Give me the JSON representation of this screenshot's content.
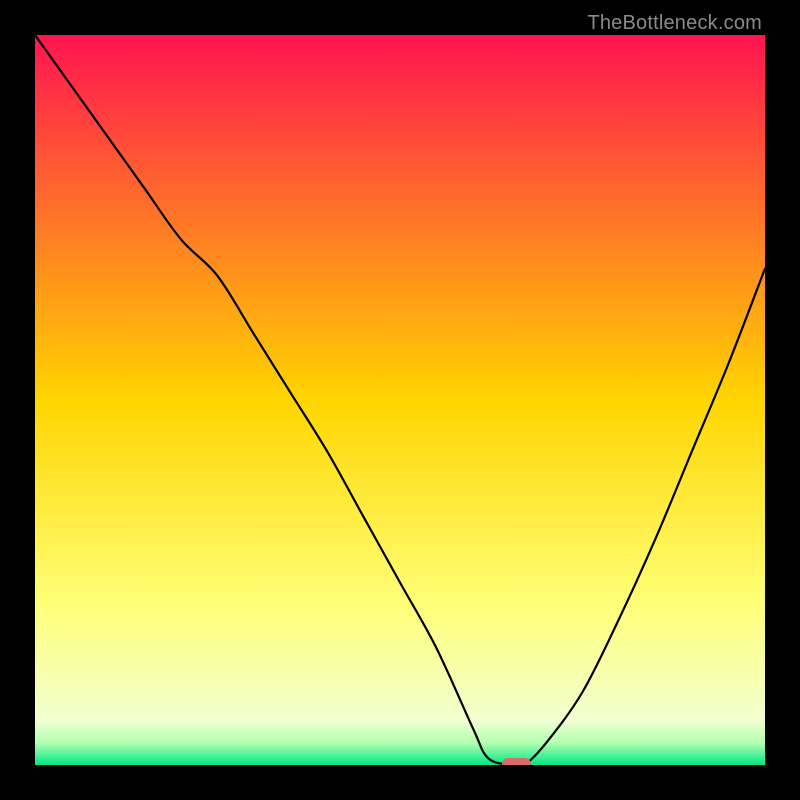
{
  "watermark": "TheBottleneck.com",
  "chart_data": {
    "type": "line",
    "title": "",
    "xlabel": "",
    "ylabel": "",
    "xlim": [
      0,
      100
    ],
    "ylim": [
      0,
      100
    ],
    "grid": false,
    "legend": false,
    "background_gradient": {
      "stops": [
        {
          "pos": 0,
          "color": "#ff1450"
        },
        {
          "pos": 50,
          "color": "#ffd500"
        },
        {
          "pos": 78,
          "color": "#ffff78"
        },
        {
          "pos": 94,
          "color": "#f0ffd0"
        },
        {
          "pos": 97,
          "color": "#b0ffb0"
        },
        {
          "pos": 100,
          "color": "#00e884"
        }
      ]
    },
    "series": [
      {
        "name": "bottleneck-curve",
        "color": "#000000",
        "x": [
          0,
          5,
          10,
          15,
          20,
          25,
          30,
          35,
          40,
          45,
          50,
          55,
          60,
          62,
          65,
          67,
          70,
          75,
          80,
          85,
          90,
          95,
          100
        ],
        "y": [
          100,
          93,
          86,
          79,
          72,
          67,
          59,
          51,
          43,
          34,
          25,
          16,
          5,
          1,
          0,
          0,
          3,
          10,
          20,
          31,
          43,
          55,
          68
        ]
      }
    ],
    "marker": {
      "name": "optimal-point",
      "shape": "pill",
      "color": "#d86a6a",
      "x": 66,
      "y": 0,
      "width_pct": 4.0,
      "height_pct": 1.8
    }
  }
}
